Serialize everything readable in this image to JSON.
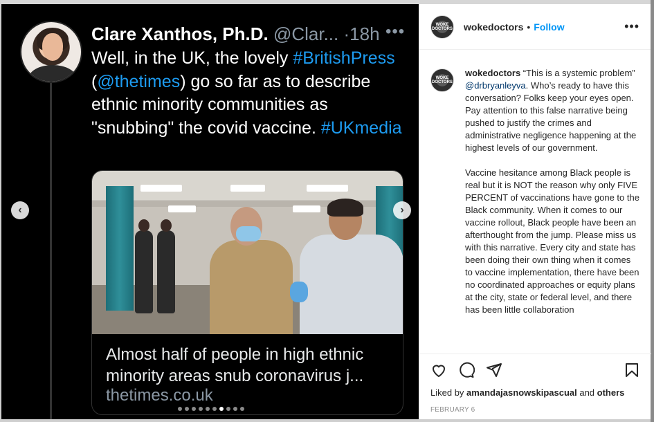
{
  "post": {
    "username": "wokedoctors",
    "follow_label": "Follow",
    "header_separator": "•",
    "more_label": "•••",
    "avatar_text": "WOKE DOCTORS",
    "caption_user": "wokedoctors",
    "caption_para1_before": " “This is a systemic problem” ",
    "caption_mention": "@drbryanleyva",
    "caption_para1_after": ". Who’s ready to have this conversation? Folks keep your eyes open. Pay attention to this false narrative being pushed to justify the crimes and administrative negligence happening at the highest levels of our government.",
    "caption_para2": "Vaccine hesitance among Black people is real but it is NOT the reason why only FIVE PERCENT of vaccinations have gone to the Black community. When it comes to our vaccine rollout, Black people have been an afterthought from the jump. Please miss us with this narrative. Every city and state has been doing their own thing when it comes to vaccine implementation, there have been no coordinated approaches or equity plans at the city, state or federal level, and there has been little collaboration",
    "likes_prefix": "Liked by ",
    "likes_user": "amandajasnowskipascual",
    "likes_mid": " and ",
    "likes_others": "others",
    "date": "FEBRUARY 6"
  },
  "tweet": {
    "name": "Clare Xanthos, Ph.D.",
    "handle": " @Clar... ",
    "time": "·18h",
    "more": "•••",
    "text_1": "Well, in the UK, the lovely ",
    "hashtag_1": "#BritishPress",
    "text_2": " (",
    "mention_1": "@thetimes",
    "text_3": ") go so far as to describe ethnic minority communities as \"snubbing\" the covid vaccine.  ",
    "hashtag_2": "#UKmedia",
    "card_title": "Almost half of people in high ethnic minority areas snub coronavirus j...",
    "card_domain": "thetimes.co.uk"
  },
  "carousel": {
    "prev_label": "‹",
    "next_label": "›",
    "dot_count": 10,
    "active_dot": 6
  },
  "icons": [
    "heart-icon",
    "comment-icon",
    "share-icon",
    "bookmark-icon",
    "chevron-left-icon",
    "chevron-right-icon"
  ]
}
